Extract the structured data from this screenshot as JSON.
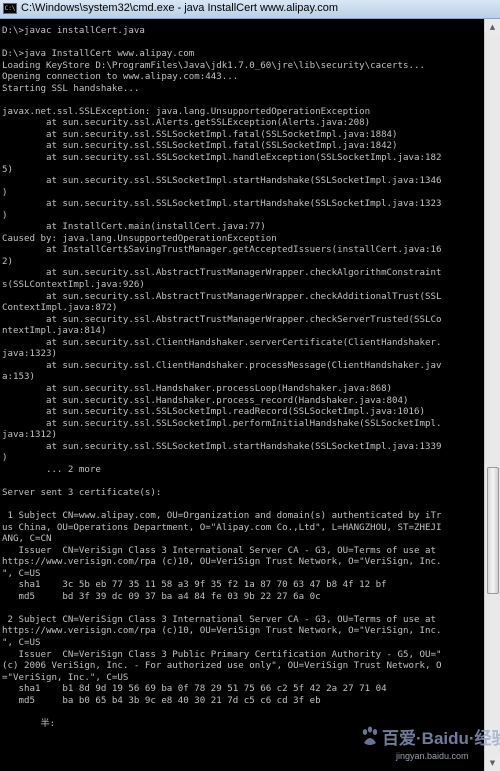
{
  "window": {
    "title": "C:\\Windows\\system32\\cmd.exe - java  InstallCert www.alipay.com",
    "icon": "cmd-icon"
  },
  "console": {
    "lines": [
      "D:\\>javac installCert.java",
      "",
      "D:\\>java InstallCert www.alipay.com",
      "Loading KeyStore D:\\ProgramFiles\\Java\\jdk1.7.0_60\\jre\\lib\\security\\cacerts...",
      "Opening connection to www.alipay.com:443...",
      "Starting SSL handshake...",
      "",
      "javax.net.ssl.SSLException: java.lang.UnsupportedOperationException",
      "        at sun.security.ssl.Alerts.getSSLException(Alerts.java:208)",
      "        at sun.security.ssl.SSLSocketImpl.fatal(SSLSocketImpl.java:1884)",
      "        at sun.security.ssl.SSLSocketImpl.fatal(SSLSocketImpl.java:1842)",
      "        at sun.security.ssl.SSLSocketImpl.handleException(SSLSocketImpl.java:182",
      "5)",
      "        at sun.security.ssl.SSLSocketImpl.startHandshake(SSLSocketImpl.java:1346",
      ")",
      "        at sun.security.ssl.SSLSocketImpl.startHandshake(SSLSocketImpl.java:1323",
      ")",
      "        at InstallCert.main(installCert.java:77)",
      "Caused by: java.lang.UnsupportedOperationException",
      "        at InstallCert$SavingTrustManager.getAcceptedIssuers(installCert.java:16",
      "2)",
      "        at sun.security.ssl.AbstractTrustManagerWrapper.checkAlgorithmConstraint",
      "s(SSLContextImpl.java:926)",
      "        at sun.security.ssl.AbstractTrustManagerWrapper.checkAdditionalTrust(SSL",
      "ContextImpl.java:872)",
      "        at sun.security.ssl.AbstractTrustManagerWrapper.checkServerTrusted(SSLCo",
      "ntextImpl.java:814)",
      "        at sun.security.ssl.ClientHandshaker.serverCertificate(ClientHandshaker.",
      "java:1323)",
      "        at sun.security.ssl.ClientHandshaker.processMessage(ClientHandshaker.jav",
      "a:153)",
      "        at sun.security.ssl.Handshaker.processLoop(Handshaker.java:868)",
      "        at sun.security.ssl.Handshaker.process_record(Handshaker.java:804)",
      "        at sun.security.ssl.SSLSocketImpl.readRecord(SSLSocketImpl.java:1016)",
      "        at sun.security.ssl.SSLSocketImpl.performInitialHandshake(SSLSocketImpl.",
      "java:1312)",
      "        at sun.security.ssl.SSLSocketImpl.startHandshake(SSLSocketImpl.java:1339",
      ")",
      "        ... 2 more",
      "",
      "Server sent 3 certificate(s):",
      "",
      " 1 Subject CN=www.alipay.com, OU=Organization and domain(s) authenticated by iTr",
      "us China, OU=Operations Department, O=\"Alipay.com Co.,Ltd\", L=HANGZHOU, ST=ZHEJI",
      "ANG, C=CN",
      "   Issuer  CN=VeriSign Class 3 International Server CA - G3, OU=Terms of use at",
      "https://www.verisign.com/rpa (c)10, OU=VeriSign Trust Network, O=\"VeriSign, Inc.",
      "\", C=US",
      "   sha1    3c 5b eb 77 35 11 58 a3 9f 35 f2 1a 87 70 63 47 b8 4f 12 bf",
      "   md5     bd 3f 39 dc 09 37 ba a4 84 fe 03 9b 22 27 6a 0c",
      "",
      " 2 Subject CN=VeriSign Class 3 International Server CA - G3, OU=Terms of use at",
      "https://www.verisign.com/rpa (c)10, OU=VeriSign Trust Network, O=\"VeriSign, Inc.",
      "\", C=US",
      "   Issuer  CN=VeriSign Class 3 Public Primary Certification Authority - G5, OU=\"",
      "(c) 2006 VeriSign, Inc. - For authorized use only\", OU=VeriSign Trust Network, O",
      "=\"VeriSign, Inc.\", C=US",
      "   sha1    b1 8d 9d 19 56 69 ba 0f 78 29 51 75 66 c2 5f 42 2a 27 71 04",
      "   md5     ba b0 65 b4 3b 9c e8 40 30 21 7d c5 c6 cd 3f eb",
      "",
      "       半:"
    ]
  },
  "watermark": {
    "text": "百爱·Baidu·经验",
    "url": "jingyan.baidu.com"
  },
  "scrollbar": {
    "position": 0.62
  }
}
